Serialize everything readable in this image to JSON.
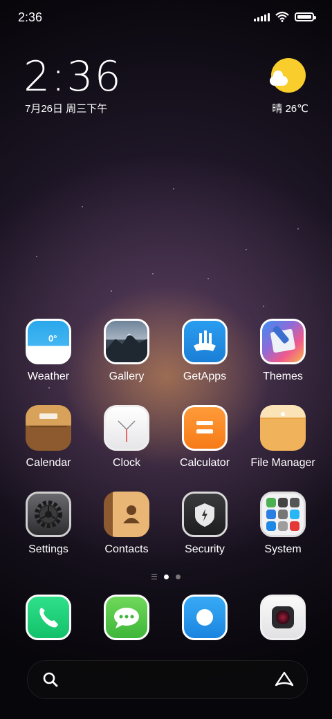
{
  "status_bar": {
    "time": "2:36"
  },
  "clock_widget": {
    "time": "2:36",
    "date": "7月26日 周三下午"
  },
  "weather_widget": {
    "text": "晴 26℃",
    "icon": "sun-cloud-icon"
  },
  "apps": [
    {
      "label": "Weather",
      "icon": "weather-icon"
    },
    {
      "label": "Gallery",
      "icon": "gallery-icon"
    },
    {
      "label": "GetApps",
      "icon": "getapps-icon"
    },
    {
      "label": "Themes",
      "icon": "themes-icon"
    },
    {
      "label": "Calendar",
      "icon": "calendar-icon"
    },
    {
      "label": "Clock",
      "icon": "clock-icon"
    },
    {
      "label": "Calculator",
      "icon": "calculator-icon"
    },
    {
      "label": "File Manager",
      "icon": "file-manager-icon"
    },
    {
      "label": "Settings",
      "icon": "settings-icon"
    },
    {
      "label": "Contacts",
      "icon": "contacts-icon"
    },
    {
      "label": "Security",
      "icon": "security-icon"
    },
    {
      "label": "System",
      "icon": "system-folder-icon"
    }
  ],
  "weather_icon_temp": "0°",
  "dock": [
    {
      "icon": "phone-icon"
    },
    {
      "icon": "messages-icon"
    },
    {
      "icon": "browser-icon"
    },
    {
      "icon": "camera-icon"
    }
  ],
  "pager": {
    "pages": 2,
    "current": 1
  },
  "search_bar": {
    "left_icon": "search-icon",
    "right_icon": "assistant-icon"
  }
}
